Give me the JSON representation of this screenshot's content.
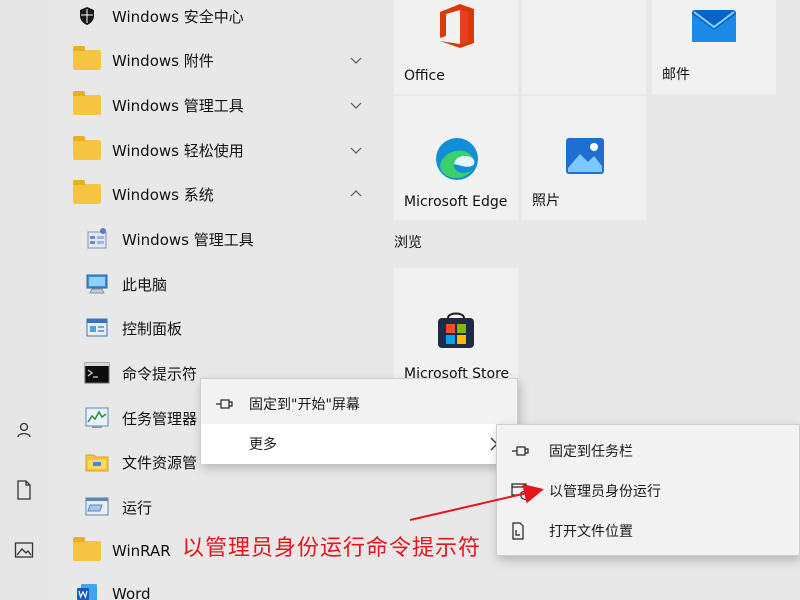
{
  "app_list": [
    {
      "label": "Windows 安全中心",
      "type": "app",
      "icon": "shield-icon"
    },
    {
      "label": "Windows 附件",
      "type": "folder",
      "chevron": "down"
    },
    {
      "label": "Windows 管理工具",
      "type": "folder",
      "chevron": "down"
    },
    {
      "label": "Windows 轻松使用",
      "type": "folder",
      "chevron": "down"
    },
    {
      "label": "Windows 系统",
      "type": "folder",
      "chevron": "up"
    },
    {
      "label": "Windows 管理工具",
      "type": "sub",
      "icon": "admin-tools-icon"
    },
    {
      "label": "此电脑",
      "type": "sub",
      "icon": "this-pc-icon"
    },
    {
      "label": "控制面板",
      "type": "sub",
      "icon": "control-panel-icon"
    },
    {
      "label": "命令提示符",
      "type": "sub",
      "icon": "cmd-icon"
    },
    {
      "label": "任务管理器",
      "type": "sub",
      "icon": "task-manager-icon"
    },
    {
      "label": "文件资源管",
      "type": "sub",
      "icon": "file-explorer-icon"
    },
    {
      "label": "运行",
      "type": "sub",
      "icon": "run-icon"
    },
    {
      "label": "WinRAR",
      "type": "folder"
    },
    {
      "label": "Word",
      "type": "app",
      "icon": "word-icon"
    }
  ],
  "tiles": {
    "office": "Office",
    "mail": "邮件",
    "edge": "Microsoft Edge",
    "photos": "照片",
    "group_browse": "浏览",
    "store": "Microsoft Store"
  },
  "context_menu": {
    "pin_start": "固定到\"开始\"屏幕",
    "more": "更多"
  },
  "submenu": {
    "pin_taskbar": "固定到任务栏",
    "run_as_admin": "以管理员身份运行",
    "open_location": "打开文件位置"
  },
  "annotation": "以管理员身份运行命令提示符",
  "colors": {
    "annotation": "#e8141b",
    "folder": "#f6c343",
    "office": "#d83b01",
    "mail": "#0078d4",
    "edge": "#0f8fd6"
  }
}
